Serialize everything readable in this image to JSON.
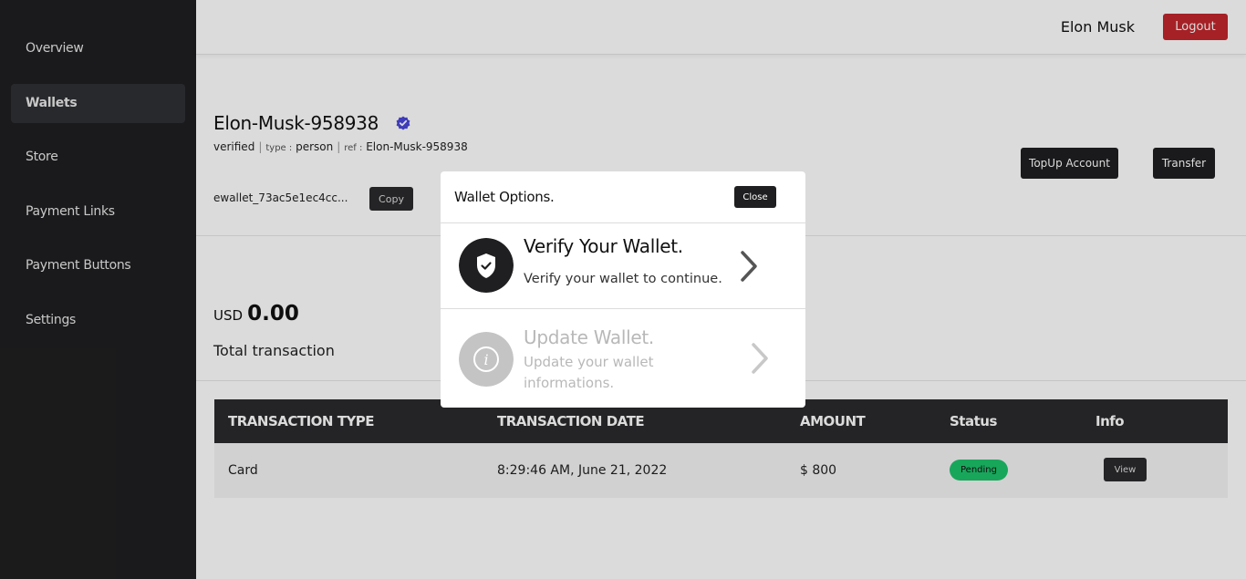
{
  "sidebar": {
    "items": [
      {
        "label": "Overview",
        "active": false
      },
      {
        "label": "Wallets",
        "active": true
      },
      {
        "label": "Store",
        "active": false
      },
      {
        "label": "Payment Links",
        "active": false
      },
      {
        "label": "Payment Buttons",
        "active": false
      },
      {
        "label": "Settings",
        "active": false
      }
    ]
  },
  "header": {
    "username": "Elon Musk",
    "logout_label": "Logout"
  },
  "wallet": {
    "name": "Elon-Musk-958938",
    "status": "verified",
    "type_label": "type :",
    "type_value": "person",
    "ref_label": "ref :",
    "ref_value": "Elon-Musk-958938",
    "id": "ewallet_73ac5e1ec4cc...",
    "copy_label": "Copy",
    "topup_label": "TopUp Account",
    "transfer_label": "Transfer",
    "currency": "USD",
    "balance": "0.00",
    "total_label": "Total transaction"
  },
  "table": {
    "headers": [
      "TRANSACTION TYPE",
      "TRANSACTION DATE",
      "AMOUNT",
      "Status",
      "Info"
    ],
    "rows": [
      {
        "type": "Card",
        "date": "8:29:46 AM, June 21, 2022",
        "amount": "$ 800",
        "status": "Pending",
        "info_label": "View"
      }
    ]
  },
  "modal": {
    "title": "Wallet Options.",
    "close_label": "Close",
    "options": [
      {
        "title": "Verify Your Wallet.",
        "subtitle": "Verify your wallet to continue.",
        "icon": "shield-check-icon",
        "enabled": true
      },
      {
        "title": "Update Wallet.",
        "subtitle": "Update your wallet informations.",
        "icon": "info-icon",
        "enabled": false
      }
    ]
  },
  "colors": {
    "sidebar_bg": "#1f1f21",
    "logout_red": "#c0272d",
    "verified_badge": "#4a46d8",
    "pending_green": "#1cc26a"
  }
}
